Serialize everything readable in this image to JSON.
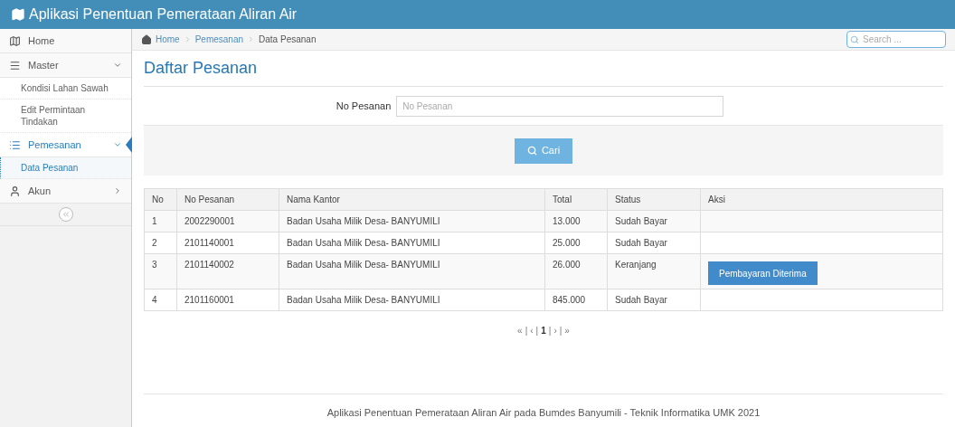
{
  "header": {
    "title": "Aplikasi Penentuan Pemerataan Aliran Air"
  },
  "sidebar": {
    "items": [
      {
        "kind": "link",
        "label": "Home",
        "selected": false
      },
      {
        "kind": "group",
        "label": "Master",
        "selected": false,
        "expanded": true,
        "children": [
          {
            "label": "Kondisi Lahan Sawah",
            "selected": false
          },
          {
            "label": "Edit Permintaan Tindakan",
            "selected": false
          }
        ]
      },
      {
        "kind": "group",
        "label": "Pemesanan",
        "selected": true,
        "expanded": true,
        "children": [
          {
            "label": "Data Pesanan",
            "selected": true
          }
        ]
      },
      {
        "kind": "group",
        "label": "Akun",
        "selected": false,
        "expanded": false
      }
    ]
  },
  "breadcrumb": [
    "Home",
    "Pemesanan",
    "Data Pesanan"
  ],
  "search": {
    "placeholder": "Search ..."
  },
  "page_title": "Daftar Pesanan",
  "filter": {
    "label": "No Pesanan",
    "placeholder": "No Pesanan",
    "button": "Cari"
  },
  "table": {
    "columns": [
      "No",
      "No Pesanan",
      "Nama Kantor",
      "Total",
      "Status",
      "Aksi"
    ],
    "rows": [
      {
        "cells": [
          "1",
          "2002290001",
          "Badan Usaha Milik Desa- BANYUMILI",
          "13.000",
          "Sudah Bayar"
        ]
      },
      {
        "cells": [
          "2",
          "2101140001",
          "Badan Usaha Milik Desa- BANYUMILI",
          "25.000",
          "Sudah Bayar"
        ]
      },
      {
        "cells": [
          "3",
          "2101140002",
          "Badan Usaha Milik Desa- BANYUMILI",
          "26.000",
          "Keranjang"
        ],
        "action": "Pembayaran Diterima"
      },
      {
        "cells": [
          "4",
          "2101160001",
          "Badan Usaha Milik Desa- BANYUMILI",
          "845.000",
          "Sudah Bayar"
        ]
      }
    ]
  },
  "pagination": {
    "separator": "|",
    "items": [
      {
        "label": "«",
        "selected": false
      },
      {
        "label": "‹",
        "selected": false
      },
      {
        "label": "1",
        "selected": true
      },
      {
        "label": "›",
        "selected": false
      },
      {
        "label": "»",
        "selected": false
      }
    ]
  },
  "footer": "Aplikasi Penentuan Pemerataan Aliran Air pada Bumdes Banyumili - Teknik Informatika UMK 2021"
}
